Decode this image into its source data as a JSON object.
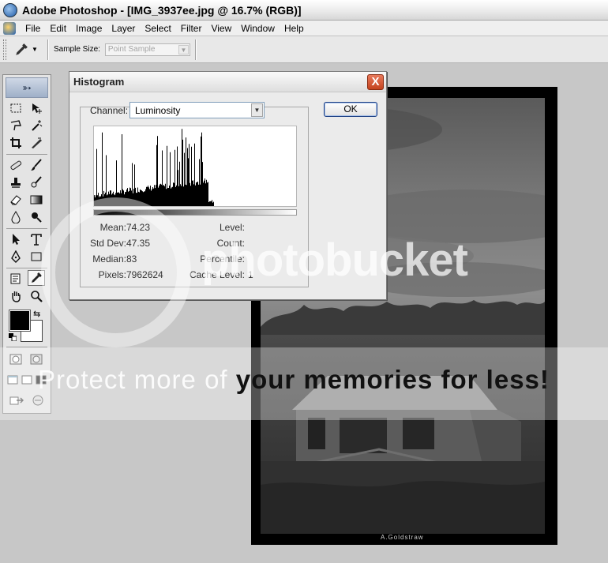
{
  "window": {
    "title": "Adobe Photoshop - [IMG_3937ee.jpg @ 16.7% (RGB)]"
  },
  "menu": [
    "File",
    "Edit",
    "Image",
    "Layer",
    "Select",
    "Filter",
    "View",
    "Window",
    "Help"
  ],
  "options_bar": {
    "sample_size_label": "Sample Size:",
    "sample_size_value": "Point Sample"
  },
  "tools": {
    "active": "eyedropper",
    "list": [
      "marquee",
      "move",
      "lasso",
      "magic-wand",
      "crop",
      "slice",
      "healing-brush",
      "brush",
      "clone-stamp",
      "history-brush",
      "eraser",
      "gradient",
      "blur",
      "dodge",
      "path-selection",
      "type",
      "pen",
      "rectangle",
      "notes",
      "eyedropper",
      "hand",
      "zoom"
    ],
    "foreground_color": "#000000",
    "background_color": "#ffffff"
  },
  "histogram_dialog": {
    "title": "Histogram",
    "channel_label": "Channel:",
    "channel_value": "Luminosity",
    "ok_label": "OK",
    "close_label": "X",
    "stats_left": [
      {
        "label": "Mean:",
        "value": "74.23"
      },
      {
        "label": "Std Dev:",
        "value": "47.35"
      },
      {
        "label": "Median:",
        "value": "83"
      },
      {
        "label": "Pixels:",
        "value": "7962624"
      }
    ],
    "stats_right": [
      {
        "label": "Level:",
        "value": ""
      },
      {
        "label": "Count:",
        "value": ""
      },
      {
        "label": "Percentile:",
        "value": ""
      },
      {
        "label": "Cache Level:",
        "value": "1"
      }
    ]
  },
  "document": {
    "credit": "A.Goldstraw"
  },
  "watermark": {
    "brand": "photobucket",
    "tagline_prefix": "Protect more of ",
    "tagline_bold": "your memories for less!"
  }
}
